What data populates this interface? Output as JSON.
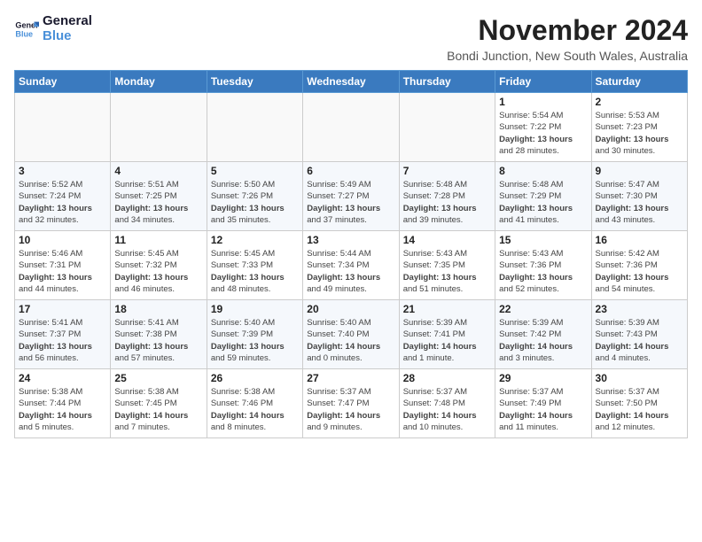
{
  "logo": {
    "line1": "General",
    "line2": "Blue"
  },
  "title": "November 2024",
  "subtitle": "Bondi Junction, New South Wales, Australia",
  "days_header": [
    "Sunday",
    "Monday",
    "Tuesday",
    "Wednesday",
    "Thursday",
    "Friday",
    "Saturday"
  ],
  "weeks": [
    [
      {
        "day": "",
        "info": ""
      },
      {
        "day": "",
        "info": ""
      },
      {
        "day": "",
        "info": ""
      },
      {
        "day": "",
        "info": ""
      },
      {
        "day": "",
        "info": ""
      },
      {
        "day": "1",
        "info": "Sunrise: 5:54 AM\nSunset: 7:22 PM\nDaylight: 13 hours\nand 28 minutes."
      },
      {
        "day": "2",
        "info": "Sunrise: 5:53 AM\nSunset: 7:23 PM\nDaylight: 13 hours\nand 30 minutes."
      }
    ],
    [
      {
        "day": "3",
        "info": "Sunrise: 5:52 AM\nSunset: 7:24 PM\nDaylight: 13 hours\nand 32 minutes."
      },
      {
        "day": "4",
        "info": "Sunrise: 5:51 AM\nSunset: 7:25 PM\nDaylight: 13 hours\nand 34 minutes."
      },
      {
        "day": "5",
        "info": "Sunrise: 5:50 AM\nSunset: 7:26 PM\nDaylight: 13 hours\nand 35 minutes."
      },
      {
        "day": "6",
        "info": "Sunrise: 5:49 AM\nSunset: 7:27 PM\nDaylight: 13 hours\nand 37 minutes."
      },
      {
        "day": "7",
        "info": "Sunrise: 5:48 AM\nSunset: 7:28 PM\nDaylight: 13 hours\nand 39 minutes."
      },
      {
        "day": "8",
        "info": "Sunrise: 5:48 AM\nSunset: 7:29 PM\nDaylight: 13 hours\nand 41 minutes."
      },
      {
        "day": "9",
        "info": "Sunrise: 5:47 AM\nSunset: 7:30 PM\nDaylight: 13 hours\nand 43 minutes."
      }
    ],
    [
      {
        "day": "10",
        "info": "Sunrise: 5:46 AM\nSunset: 7:31 PM\nDaylight: 13 hours\nand 44 minutes."
      },
      {
        "day": "11",
        "info": "Sunrise: 5:45 AM\nSunset: 7:32 PM\nDaylight: 13 hours\nand 46 minutes."
      },
      {
        "day": "12",
        "info": "Sunrise: 5:45 AM\nSunset: 7:33 PM\nDaylight: 13 hours\nand 48 minutes."
      },
      {
        "day": "13",
        "info": "Sunrise: 5:44 AM\nSunset: 7:34 PM\nDaylight: 13 hours\nand 49 minutes."
      },
      {
        "day": "14",
        "info": "Sunrise: 5:43 AM\nSunset: 7:35 PM\nDaylight: 13 hours\nand 51 minutes."
      },
      {
        "day": "15",
        "info": "Sunrise: 5:43 AM\nSunset: 7:36 PM\nDaylight: 13 hours\nand 52 minutes."
      },
      {
        "day": "16",
        "info": "Sunrise: 5:42 AM\nSunset: 7:36 PM\nDaylight: 13 hours\nand 54 minutes."
      }
    ],
    [
      {
        "day": "17",
        "info": "Sunrise: 5:41 AM\nSunset: 7:37 PM\nDaylight: 13 hours\nand 56 minutes."
      },
      {
        "day": "18",
        "info": "Sunrise: 5:41 AM\nSunset: 7:38 PM\nDaylight: 13 hours\nand 57 minutes."
      },
      {
        "day": "19",
        "info": "Sunrise: 5:40 AM\nSunset: 7:39 PM\nDaylight: 13 hours\nand 59 minutes."
      },
      {
        "day": "20",
        "info": "Sunrise: 5:40 AM\nSunset: 7:40 PM\nDaylight: 14 hours\nand 0 minutes."
      },
      {
        "day": "21",
        "info": "Sunrise: 5:39 AM\nSunset: 7:41 PM\nDaylight: 14 hours\nand 1 minute."
      },
      {
        "day": "22",
        "info": "Sunrise: 5:39 AM\nSunset: 7:42 PM\nDaylight: 14 hours\nand 3 minutes."
      },
      {
        "day": "23",
        "info": "Sunrise: 5:39 AM\nSunset: 7:43 PM\nDaylight: 14 hours\nand 4 minutes."
      }
    ],
    [
      {
        "day": "24",
        "info": "Sunrise: 5:38 AM\nSunset: 7:44 PM\nDaylight: 14 hours\nand 5 minutes."
      },
      {
        "day": "25",
        "info": "Sunrise: 5:38 AM\nSunset: 7:45 PM\nDaylight: 14 hours\nand 7 minutes."
      },
      {
        "day": "26",
        "info": "Sunrise: 5:38 AM\nSunset: 7:46 PM\nDaylight: 14 hours\nand 8 minutes."
      },
      {
        "day": "27",
        "info": "Sunrise: 5:37 AM\nSunset: 7:47 PM\nDaylight: 14 hours\nand 9 minutes."
      },
      {
        "day": "28",
        "info": "Sunrise: 5:37 AM\nSunset: 7:48 PM\nDaylight: 14 hours\nand 10 minutes."
      },
      {
        "day": "29",
        "info": "Sunrise: 5:37 AM\nSunset: 7:49 PM\nDaylight: 14 hours\nand 11 minutes."
      },
      {
        "day": "30",
        "info": "Sunrise: 5:37 AM\nSunset: 7:50 PM\nDaylight: 14 hours\nand 12 minutes."
      }
    ]
  ]
}
